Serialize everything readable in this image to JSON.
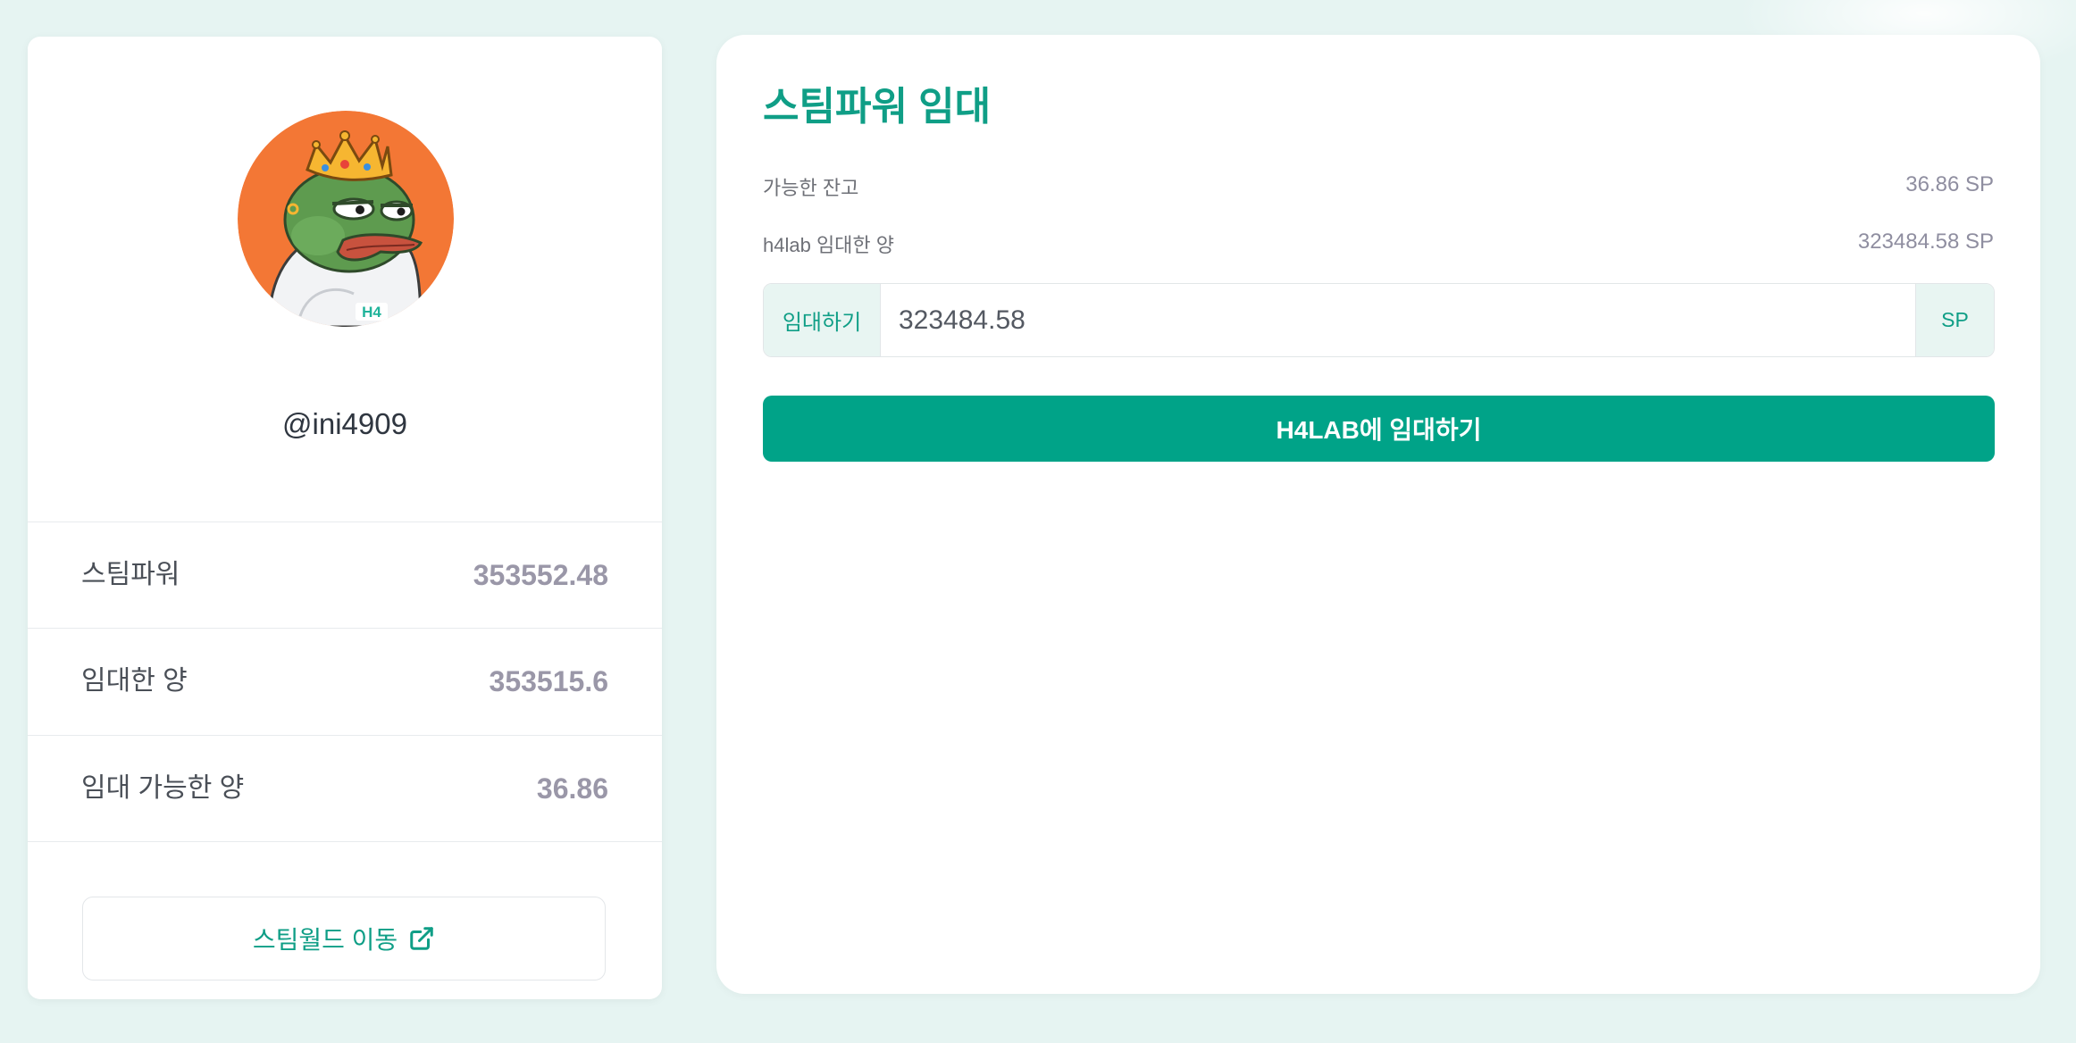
{
  "profile": {
    "username": "@ini4909",
    "avatar_icon": "crowned-frog-avatar",
    "avatar_badge_text": "H4",
    "avatar_bg_color": "#f37735",
    "stats": [
      {
        "label": "스팀파워",
        "value": "353552.48"
      },
      {
        "label": "임대한 양",
        "value": "353515.6"
      },
      {
        "label": "임대 가능한 양",
        "value": "36.86"
      }
    ],
    "steemworld_button_label": "스팀월드 이동",
    "steemworld_icon": "external-link-icon"
  },
  "delegate": {
    "title": "스팀파워 임대",
    "available_label": "가능한 잔고",
    "available_value": "36.86 SP",
    "delegated_label": "h4lab 임대한 양",
    "delegated_value": "323484.58 SP",
    "input_prefix": "임대하기",
    "input_value": "323484.58",
    "input_suffix": "SP",
    "submit_label": "H4LAB에 임대하기"
  },
  "colors": {
    "accent": "#00a388",
    "accent_text": "#0f9e86",
    "background": "#e6f4f2"
  }
}
